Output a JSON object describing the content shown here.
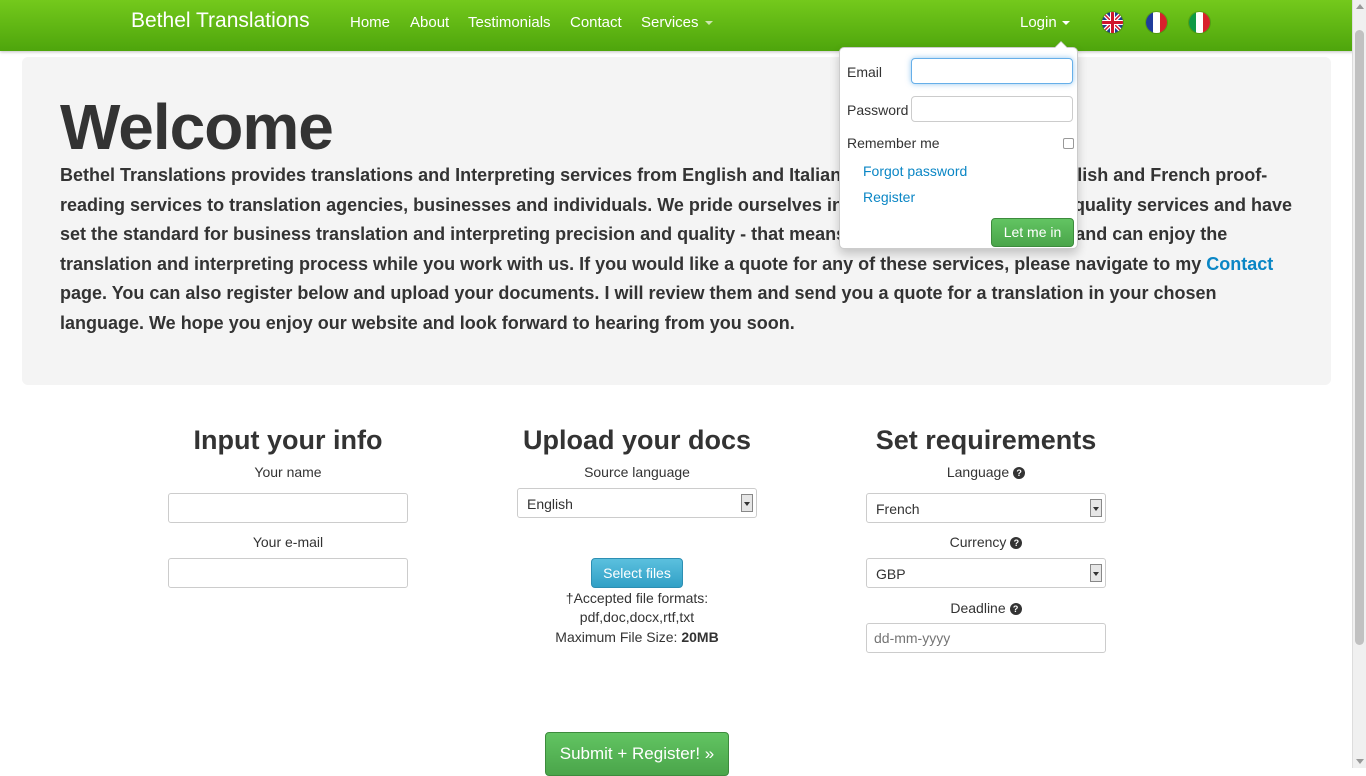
{
  "navbar": {
    "brand": "Bethel Translations",
    "items": [
      "Home",
      "About",
      "Testimonials",
      "Contact"
    ],
    "services_label": "Services",
    "login_label": "Login",
    "flags": [
      "uk-flag-icon",
      "france-flag-icon",
      "italy-flag-icon"
    ]
  },
  "hero": {
    "title": "Welcome",
    "text_before_link": "Bethel Translations provides translations and Interpreting services from English and Italian into French, as well as English and French proof-reading services to translation agencies, businesses and individuals. We pride ourselves in our ability to provide high quality services and have set the standard for business translation and interpreting precision and quality - that means you save time and money and can enjoy the translation and interpreting process while you work with us. If you would like a quote for any of these services, please navigate to my ",
    "link_text": "Contact",
    "text_after_link": " page. You can also register below and upload your documents. I will review them and send you a quote for a translation in your chosen language. We hope you enjoy our website and look forward to hearing from you soon."
  },
  "login_dropdown": {
    "email_label": "Email",
    "email_value": "",
    "password_label": "Password",
    "password_value": "",
    "remember_label": "Remember me",
    "forgot_link": "Forgot password",
    "register_link": "Register",
    "submit_label": "Let me in"
  },
  "info_column": {
    "heading": "Input your info",
    "name_label": "Your name",
    "name_value": "",
    "email_label": "Your e-mail",
    "email_value": ""
  },
  "upload_column": {
    "heading": "Upload your docs",
    "source_label": "Source language",
    "source_value": "English",
    "select_files_label": "Select files",
    "formats_line1": "†Accepted file formats:",
    "formats_line2": "pdf,doc,docx,rtf,txt",
    "max_size_label": "Maximum File Size: ",
    "max_size_value": "20MB"
  },
  "requirements_column": {
    "heading": "Set requirements",
    "language_label": "Language",
    "language_value": "French",
    "currency_label": "Currency",
    "currency_value": "GBP",
    "deadline_label": "Deadline",
    "deadline_placeholder": "dd-mm-yyyy",
    "help_glyph": "?"
  },
  "submit_button": "Submit + Register! »",
  "colors": {
    "navbar": "#5cb615",
    "link": "#0a86c5",
    "button_green": "#5cb85c",
    "button_blue": "#5bc0de"
  }
}
